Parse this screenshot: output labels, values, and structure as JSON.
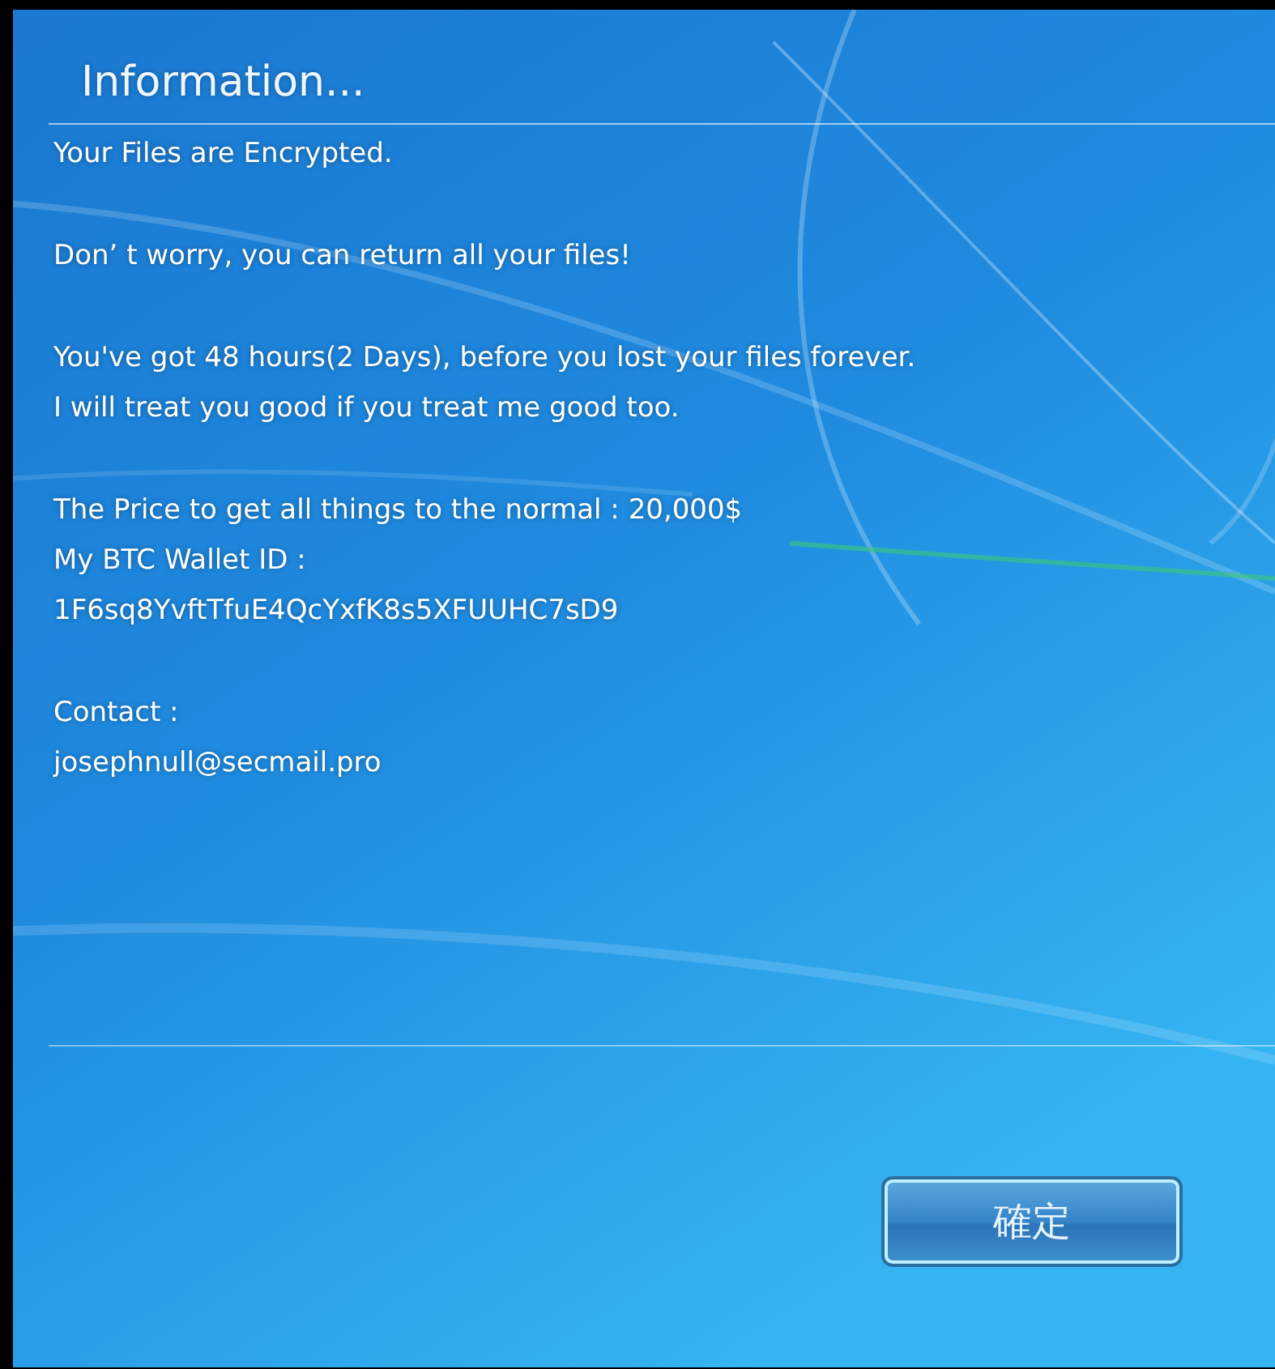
{
  "dialog": {
    "title": "Information...",
    "paragraphs": [
      [
        "Your Files are Encrypted."
      ],
      [
        "Don’ t worry, you can return all your files!"
      ],
      [
        "You've got 48 hours(2 Days), before you lost your files forever.",
        "I will treat you good if you treat me good too."
      ],
      [
        "The Price to get all things to the normal : 20,000$",
        "My BTC Wallet ID :",
        "1F6sq8YvftTfuE4QcYxfK8s5XFUUHC7sD9"
      ],
      [
        "Contact :",
        "josephnull@secmail.pro"
      ]
    ],
    "buttons": [
      "確定"
    ]
  }
}
